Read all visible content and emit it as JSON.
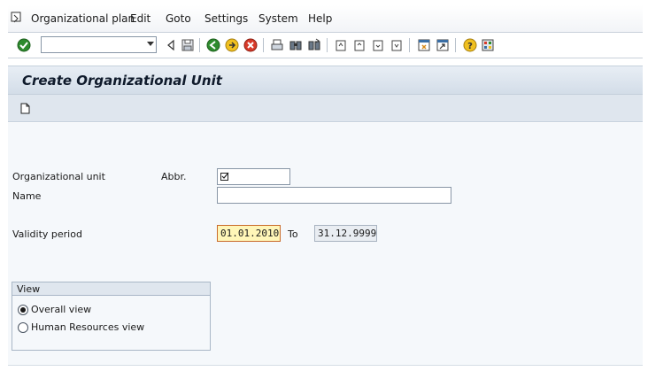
{
  "menubar": {
    "items": [
      {
        "label": "Organizational plan"
      },
      {
        "label": "Edit"
      },
      {
        "label": "Goto"
      },
      {
        "label": "Settings"
      },
      {
        "label": "System"
      },
      {
        "label": "Help"
      }
    ]
  },
  "toolbar": {
    "command_field": {
      "value": ""
    }
  },
  "page": {
    "title": "Create Organizational Unit"
  },
  "form": {
    "org_unit": {
      "label": "Organizational unit",
      "abbr_label": "Abbr.",
      "abbr_value": ""
    },
    "name": {
      "label": "Name",
      "value": ""
    },
    "validity": {
      "label": "Validity period",
      "from": "01.01.2010",
      "to_label": "To",
      "to": "31.12.9999"
    }
  },
  "view": {
    "title": "View",
    "options": [
      {
        "label": "Overall view",
        "selected": true
      },
      {
        "label": "Human Resources view",
        "selected": false
      }
    ]
  }
}
